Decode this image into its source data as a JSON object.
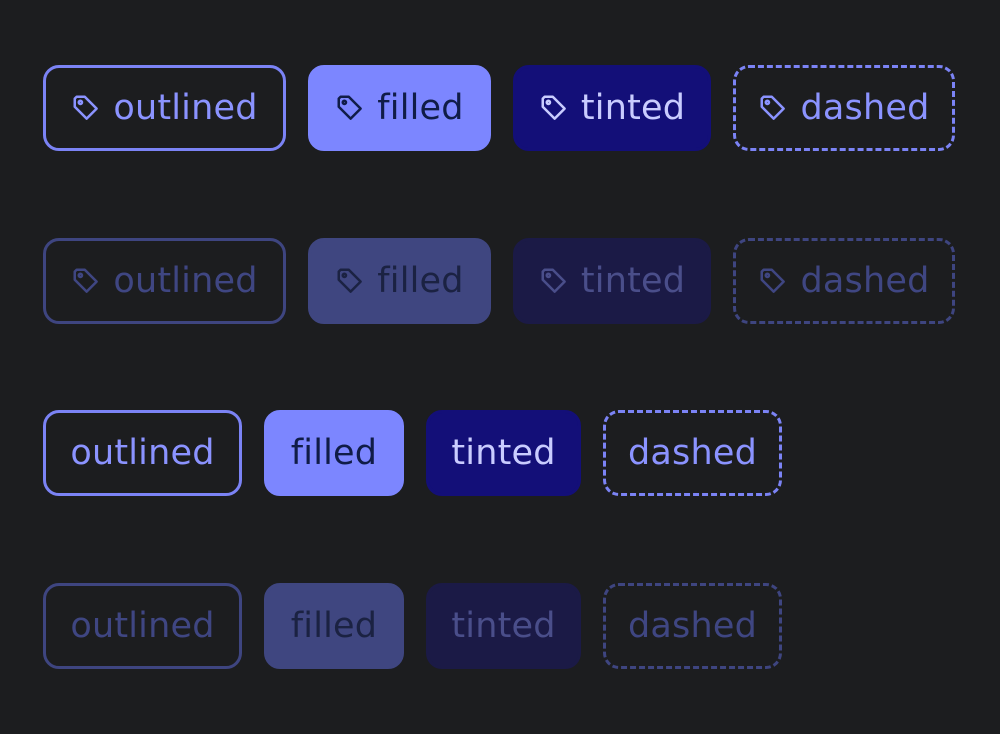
{
  "rows": [
    {
      "state": "enabled",
      "with_icon": true,
      "chips": [
        {
          "variant": "outlined",
          "label": "outlined",
          "icon": "tag-icon"
        },
        {
          "variant": "filled",
          "label": "filled",
          "icon": "tag-icon"
        },
        {
          "variant": "tinted",
          "label": "tinted",
          "icon": "tag-icon"
        },
        {
          "variant": "dashed",
          "label": "dashed",
          "icon": "tag-icon"
        }
      ]
    },
    {
      "state": "disabled",
      "with_icon": true,
      "chips": [
        {
          "variant": "outlined",
          "label": "outlined",
          "icon": "tag-icon"
        },
        {
          "variant": "filled",
          "label": "filled",
          "icon": "tag-icon"
        },
        {
          "variant": "tinted",
          "label": "tinted",
          "icon": "tag-icon"
        },
        {
          "variant": "dashed",
          "label": "dashed",
          "icon": "tag-icon"
        }
      ]
    },
    {
      "state": "enabled",
      "with_icon": false,
      "chips": [
        {
          "variant": "outlined",
          "label": "outlined"
        },
        {
          "variant": "filled",
          "label": "filled"
        },
        {
          "variant": "tinted",
          "label": "tinted"
        },
        {
          "variant": "dashed",
          "label": "dashed"
        }
      ]
    },
    {
      "state": "disabled",
      "with_icon": false,
      "chips": [
        {
          "variant": "outlined",
          "label": "outlined"
        },
        {
          "variant": "filled",
          "label": "filled"
        },
        {
          "variant": "tinted",
          "label": "tinted"
        },
        {
          "variant": "dashed",
          "label": "dashed"
        }
      ]
    }
  ],
  "colors": {
    "background": "#1c1d1f",
    "accent": "#7c86ff",
    "tinted_bg": "#130f78"
  }
}
